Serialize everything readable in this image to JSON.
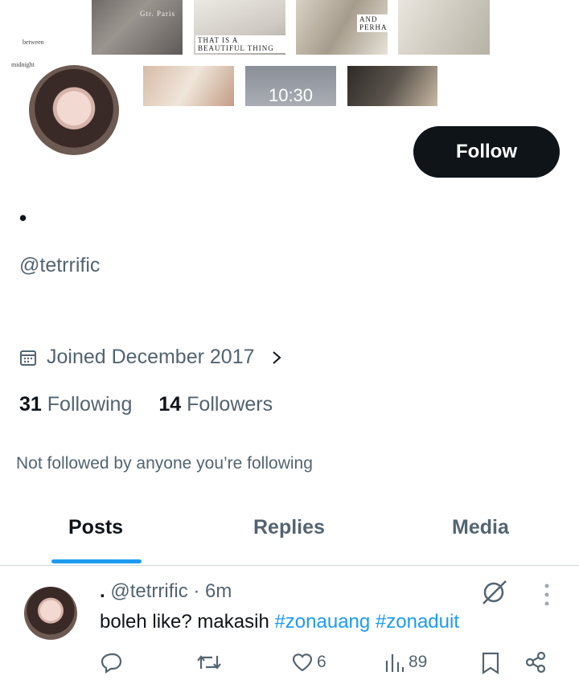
{
  "banner": {
    "tile_captions": [
      "Gtr. Paris",
      "THAT IS A BEAUTIFUL THING",
      "AND PERHAPS,"
    ],
    "clock": "10:30",
    "margin_words": [
      "between",
      "midnight"
    ]
  },
  "profile": {
    "display_name": "•",
    "handle": "@tetrrific",
    "joined": "Joined December 2017",
    "following_count": "31",
    "following_label": "Following",
    "followers_count": "14",
    "followers_label": "Followers",
    "not_followed_text": "Not followed by anyone you’re following",
    "follow_button": "Follow"
  },
  "tabs": [
    {
      "label": "Posts",
      "active": true
    },
    {
      "label": "Replies",
      "active": false
    },
    {
      "label": "Media",
      "active": false
    }
  ],
  "post": {
    "name": ".",
    "handle": "@tetrrific",
    "time": "· 6m",
    "text": "boleh like? makasih ",
    "hashtags": [
      "#zonauang",
      "#zonaduit"
    ],
    "likes": "6",
    "views": "89"
  },
  "colors": {
    "accent": "#1d9bf0",
    "text": "#0f1419",
    "muted": "#536471",
    "button": "#0f1419"
  }
}
